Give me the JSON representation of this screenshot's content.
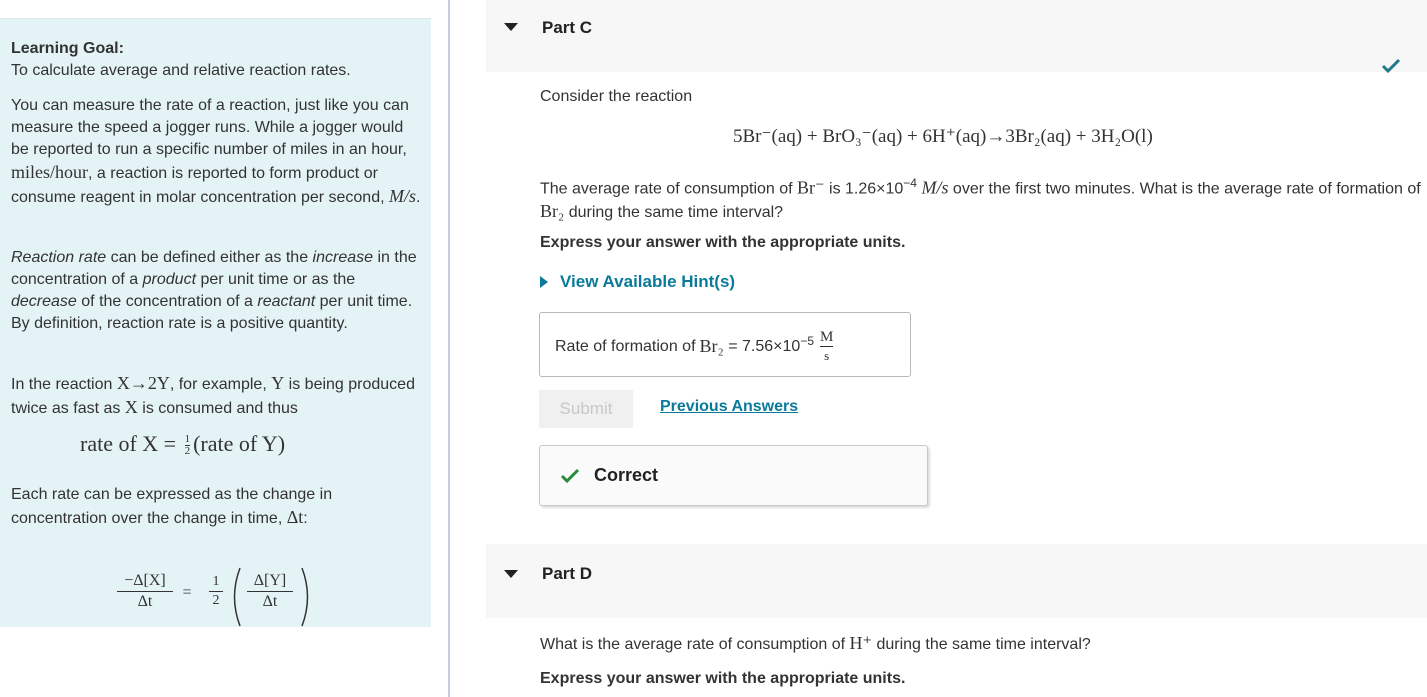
{
  "sidebar": {
    "goal_title": "Learning Goal:",
    "goal_text": "To calculate average and relative reaction rates.",
    "p1_a": "You can measure the rate of a reaction, just like you can measure the speed a jogger runs. While a jogger would be reported to run a specific number of miles in an hour, ",
    "p1_math1": "miles/hour",
    "p1_b": ", a reaction is reported to form product or consume reagent in molar concentration per second, ",
    "p1_math2": "M/s",
    "p1_c": ".",
    "p2_a": "Reaction rate",
    "p2_b": " can be defined either as the ",
    "p2_c": "increase",
    "p2_d": " in the concentration of a ",
    "p2_e": "product",
    "p2_f": " per unit time or as the ",
    "p2_g": "decrease",
    "p2_h": " of the concentration of a ",
    "p2_i": "reactant",
    "p2_j": " per unit time. By definition, reaction rate is a positive quantity.",
    "p3_a": "In the reaction ",
    "p3_math1": "X→2Y",
    "p3_b": ", for example, ",
    "p3_math2": "Y",
    "p3_c": " is being produced twice as fast as ",
    "p3_math3": "X",
    "p3_d": " is consumed and thus",
    "formula1_left": "rate of X = ",
    "formula1_num": "1",
    "formula1_den": "2",
    "formula1_right": "(rate of Y)",
    "p4_a": "Each rate can be expressed as the change in concentration over the change in time, ",
    "p4_math": "Δt",
    "p4_b": ":",
    "f2_num1": "−Δ[X]",
    "f2_den1": "Δt",
    "f2_eq": "=",
    "f2_num2": "1",
    "f2_den2": "2",
    "f2_num3": "Δ[Y]",
    "f2_den3": "Δt"
  },
  "part_c": {
    "label": "Part C",
    "intro": "Consider the reaction",
    "equation": "5Br⁻(aq) + BrO₃⁻(aq) + 6H⁺(aq)→3Br₂(aq) + 3H₂O(l)",
    "q_a": "The average rate of consumption of ",
    "q_br": "Br⁻",
    "q_b": " is 1.26×10",
    "q_exp": "−4",
    "q_unit": " M/s",
    "q_c": " over the first two minutes. What is the average rate of formation of ",
    "q_br2": "Br₂",
    "q_d": " during the same time interval?",
    "instruction": "Express your answer with the appropriate units.",
    "hint_label": "View Available Hint(s)",
    "answer_label": "Rate of formation of ",
    "answer_species": "Br₂",
    "answer_eq": " = ",
    "answer_mantissa": "7.56×10",
    "answer_exp": "−5",
    "answer_unit_num": "M",
    "answer_unit_den": "s",
    "submit_label": "Submit",
    "previous_label": "Previous Answers",
    "correct_label": "Correct"
  },
  "part_d": {
    "label": "Part D",
    "q_a": "What is the average rate of consumption of ",
    "q_h": "H⁺",
    "q_b": " during the same time interval?",
    "instruction": "Express your answer with the appropriate units."
  },
  "colors": {
    "sidebar_bg": "#e4f3f5",
    "link": "#0a7a9b",
    "check": "#2a8a3a"
  }
}
